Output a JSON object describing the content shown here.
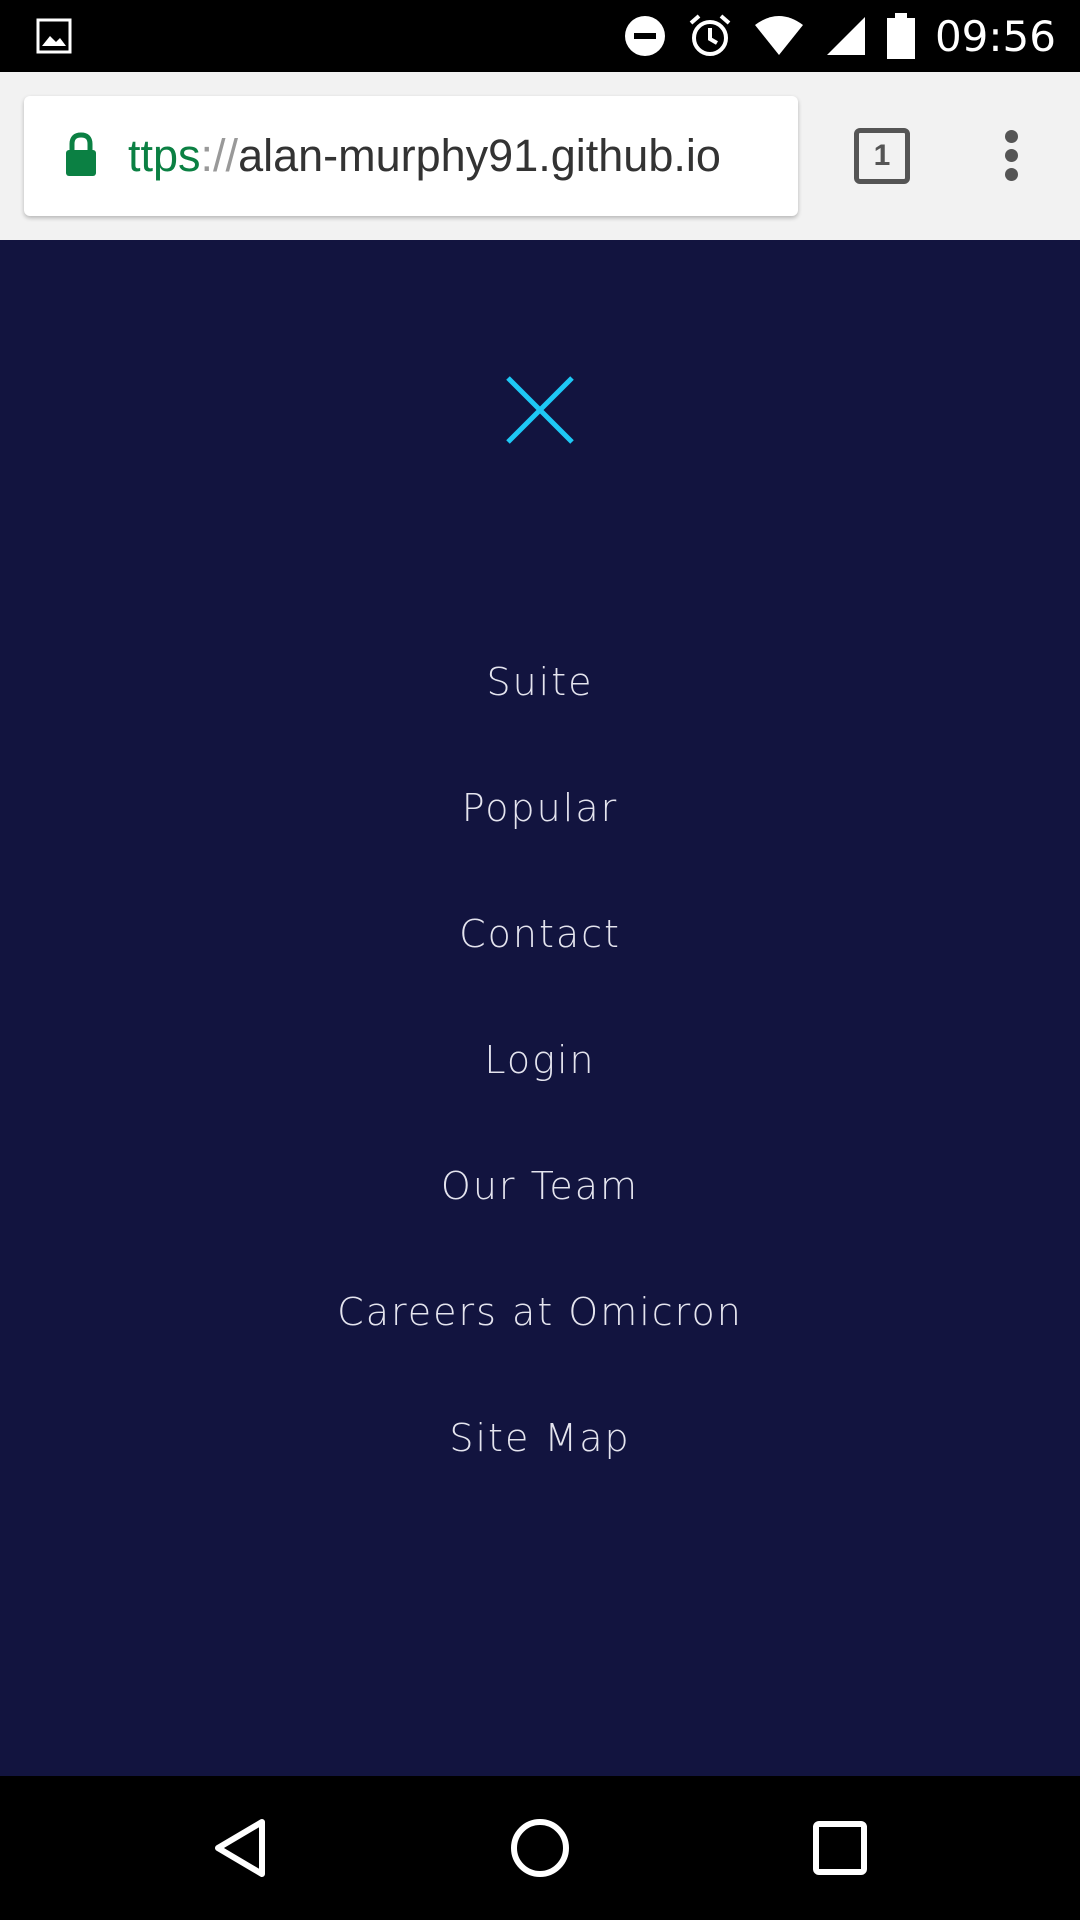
{
  "status_bar": {
    "time": "09:56",
    "icons": [
      "image-notification-icon",
      "do-not-disturb-icon",
      "alarm-icon",
      "wifi-icon",
      "cell-signal-icon",
      "battery-icon"
    ]
  },
  "browser": {
    "url_scheme": "ttps",
    "url_separator": "://",
    "url_host": "alan-murphy91.github.io",
    "tab_count": "1",
    "secure_color": "#0b8043"
  },
  "page": {
    "background_color": "#12143f",
    "close_icon_color": "#1ec8f5",
    "nav_items": [
      {
        "label": "Suite"
      },
      {
        "label": "Popular"
      },
      {
        "label": "Contact"
      },
      {
        "label": "Login"
      },
      {
        "label": "Our Team"
      },
      {
        "label": "Careers at Omicron"
      },
      {
        "label": "Site Map"
      }
    ]
  },
  "system_nav": {
    "buttons": [
      "back-icon",
      "home-icon",
      "recents-icon"
    ]
  }
}
